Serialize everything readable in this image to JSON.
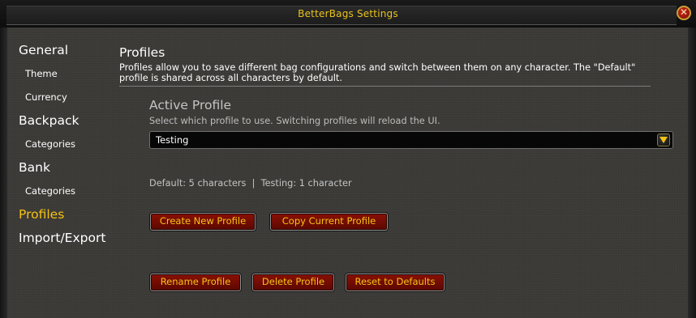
{
  "window": {
    "title": "BetterBags Settings",
    "close_glyph": "✕"
  },
  "sidebar": {
    "items": [
      {
        "label": "General",
        "level": 0,
        "selected": false
      },
      {
        "label": "Theme",
        "level": 1,
        "selected": false
      },
      {
        "label": "Currency",
        "level": 1,
        "selected": false
      },
      {
        "label": "Backpack",
        "level": 0,
        "selected": false
      },
      {
        "label": "Categories",
        "level": 1,
        "selected": false
      },
      {
        "label": "Bank",
        "level": 0,
        "selected": false
      },
      {
        "label": "Categories",
        "level": 1,
        "selected": false
      },
      {
        "label": "Profiles",
        "level": 0,
        "selected": true
      },
      {
        "label": "Import/Export",
        "level": 0,
        "selected": false
      }
    ]
  },
  "main": {
    "title": "Profiles",
    "description": "Profiles allow you to save different bag configurations and switch between them on any character. The \"Default\" profile is shared across all characters by default.",
    "active_profile": {
      "heading": "Active Profile",
      "hint": "Select which profile to use. Switching profiles will reload the UI.",
      "selected_value": "Testing"
    },
    "status": "Default: 5 characters  |  Testing: 1 character",
    "buttons": {
      "create": "Create New Profile",
      "copy": "Copy Current Profile",
      "rename": "Rename Profile",
      "delete": "Delete Profile",
      "reset": "Reset to Defaults"
    }
  },
  "colors": {
    "accent_gold": "#f5c211",
    "button_red": "#7a0d02",
    "background": "#3b3a37"
  }
}
